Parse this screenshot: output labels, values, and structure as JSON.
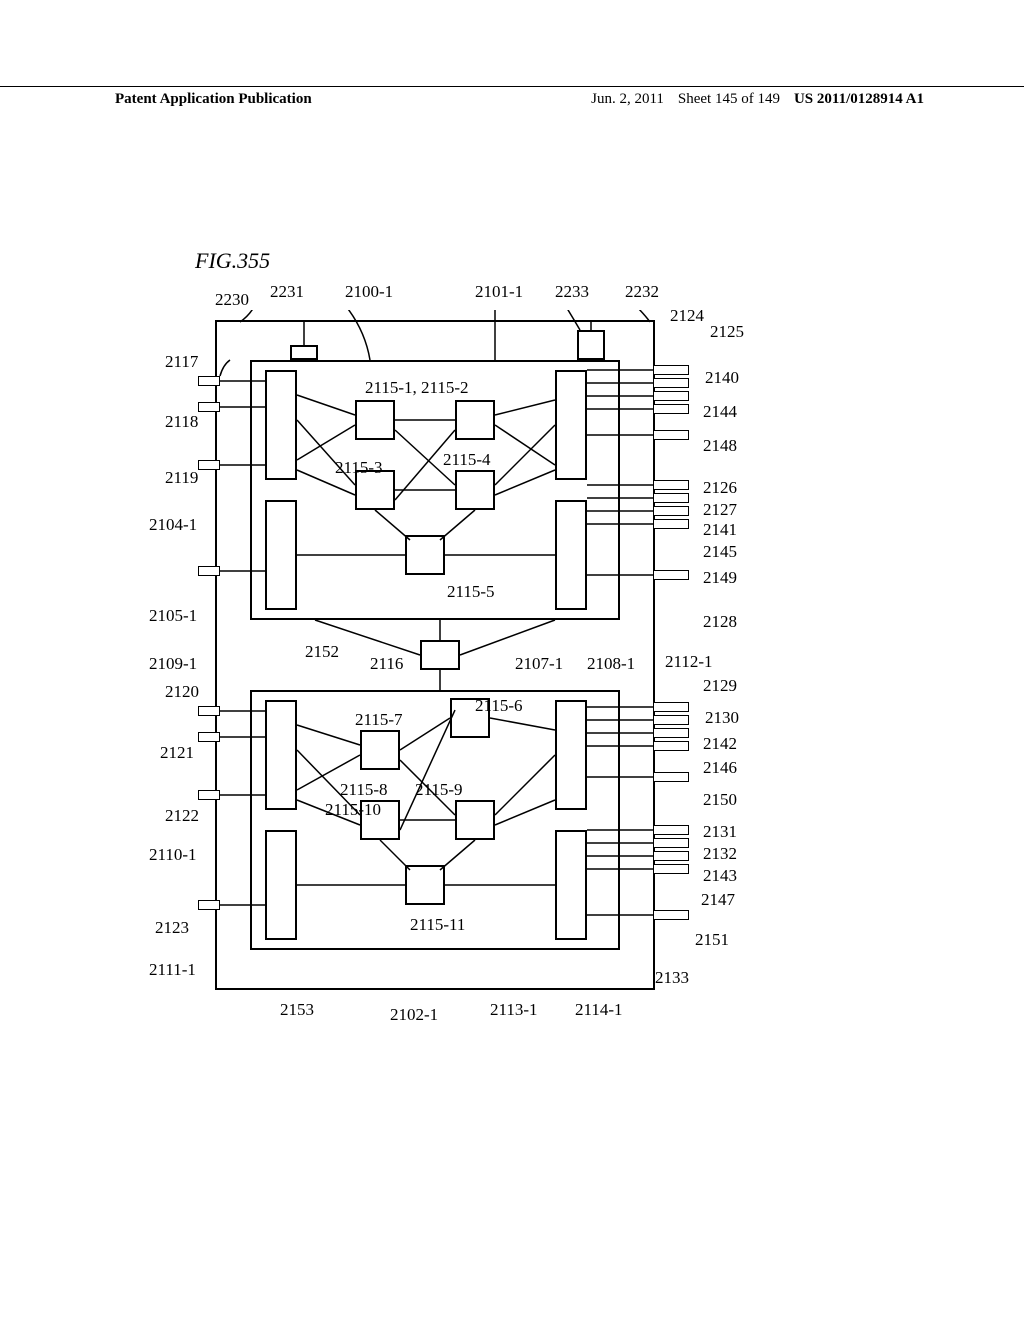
{
  "header": {
    "left": "Patent Application Publication",
    "date": "Jun. 2, 2011",
    "sheet": "Sheet 145 of 149",
    "pubno": "US 2011/0128914 A1"
  },
  "figure_label": "FIG.355",
  "labels": {
    "l2230": "2230",
    "l2231": "2231",
    "l2100_1": "2100-1",
    "l2101_1": "2101-1",
    "l2233": "2233",
    "l2232": "2232",
    "l2124": "2124",
    "l2125": "2125",
    "l2117": "2117",
    "l2140": "2140",
    "l2118": "2118",
    "l2144": "2144",
    "l2148": "2148",
    "l2119": "2119",
    "l2115_1_2": "2115-1, 2115-2",
    "l2115_3": "2115-3",
    "l2115_4": "2115-4",
    "l2126": "2126",
    "l2127": "2127",
    "l2104_1": "2104-1",
    "l2141": "2141",
    "l2145": "2145",
    "l2149": "2149",
    "l2105_1": "2105-1",
    "l2115_5": "2115-5",
    "l2128": "2128",
    "l2109_1": "2109-1",
    "l2152": "2152",
    "l2116": "2116",
    "l2107_1": "2107-1",
    "l2108_1": "2108-1",
    "l2112_1": "2112-1",
    "l2129": "2129",
    "l2120": "2120",
    "l2130": "2130",
    "l2115_6": "2115-6",
    "l2115_7": "2115-7",
    "l2142": "2142",
    "l2121": "2121",
    "l2146": "2146",
    "l2115_8": "2115-8",
    "l2115_9": "2115-9",
    "l2150": "2150",
    "l2122": "2122",
    "l2115_10": "2115-10",
    "l2131": "2131",
    "l2110_1": "2110-1",
    "l2132": "2132",
    "l2143": "2143",
    "l2147": "2147",
    "l2123": "2123",
    "l2115_11": "2115-11",
    "l2151": "2151",
    "l2111_1": "2111-1",
    "l2133": "2133",
    "l2153": "2153",
    "l2102_1": "2102-1",
    "l2113_1": "2113-1",
    "l2114_1": "2114-1"
  }
}
